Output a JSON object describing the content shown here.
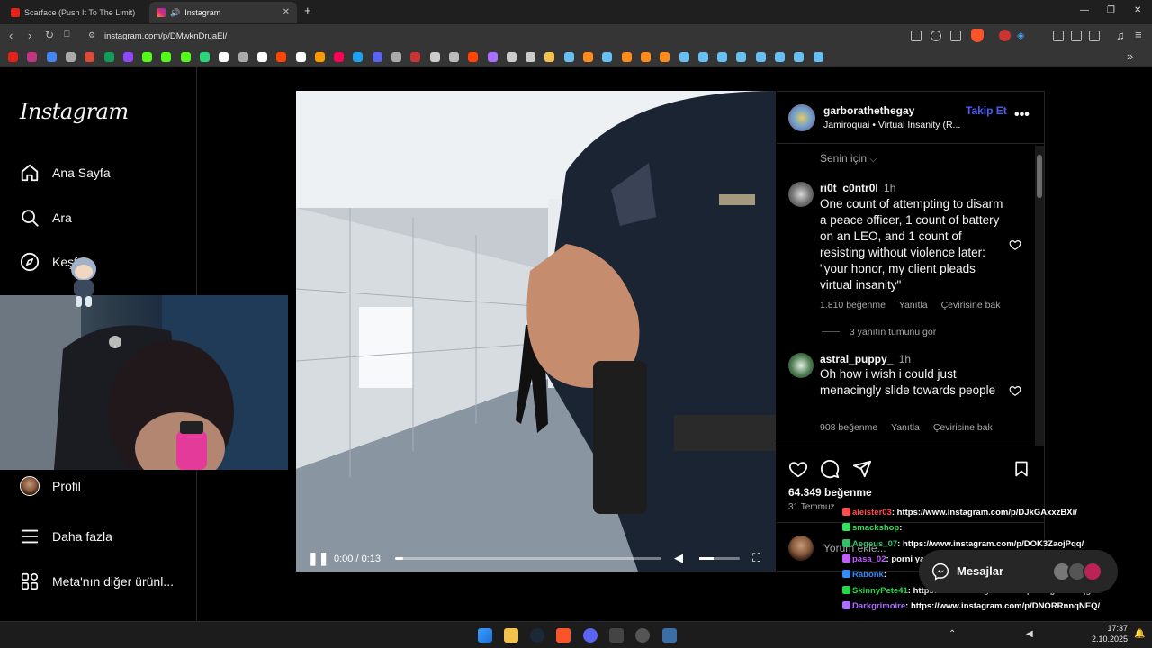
{
  "browser": {
    "tabs": [
      {
        "title": "Scarface (Push It To The Limit) - YouTube",
        "active": false
      },
      {
        "title": "Instagram",
        "active": true
      }
    ],
    "url": "instagram.com/p/DMwknDruaEl/"
  },
  "sidebar": {
    "logo": "Instagram",
    "items": [
      {
        "label": "Ana Sayfa",
        "icon": "home-icon"
      },
      {
        "label": "Ara",
        "icon": "search-icon"
      },
      {
        "label": "Keşfet",
        "icon": "compass-icon"
      },
      {
        "label": "Profil",
        "icon": "avatar"
      },
      {
        "label": "Daha fazla",
        "icon": "menu-icon"
      },
      {
        "label": "Meta'nın diğer ürünl...",
        "icon": "apps-icon"
      }
    ]
  },
  "video": {
    "time": "0:00 / 0:13",
    "progress": 0.03
  },
  "post": {
    "author": "garborathethegay",
    "follow_label": "Takip Et",
    "audio": "Jamiroquai • Virtual Insanity (R...",
    "sort_label": "Senin için",
    "comments": [
      {
        "user": "ri0t_c0ntr0l",
        "time": "1h",
        "text": "One count of attempting to disarm a peace officer, 1 count of battery on an LEO, and 1 count of resisting without violence later: \"your honor, my client pleads virtual insanity\"",
        "likes": "1.810 beğenme",
        "reply": "Yanıtla",
        "translate": "Çevirisine bak",
        "view_replies": "3 yanıtın tümünü gör"
      },
      {
        "user": "astral_puppy_",
        "time": "1h",
        "text": "Oh how i wish i could just menacingly slide towards people",
        "likes": "908 beğenme",
        "reply": "Yanıtla",
        "translate": "Çevirisine bak"
      }
    ],
    "like_count": "64.349 beğenme",
    "date": "31 Temmuz",
    "comment_placeholder": "Yorum ekle..."
  },
  "chat": [
    {
      "user": "aleister03",
      "color": "#ff4d4d",
      "message": ": https://www.instagram.com/p/DJkGAxxzBXi/"
    },
    {
      "user": "smackshop",
      "color": "#34e05a",
      "message": ": "
    },
    {
      "user": "Aegeus_07",
      "color": "#33c06b",
      "message": ": https://www.instagram.com/p/DOK3ZaojPqq/"
    },
    {
      "user": "pasa_02",
      "color": "#c35cff",
      "message": ": porni yazio"
    },
    {
      "user": "Rabonk",
      "color": "#2f8cff",
      "message": ": "
    },
    {
      "user": "SkinnyPete41",
      "color": "#22d94a",
      "message": ": https://www.instagram.com/p/DOqjV-oCBqg/"
    },
    {
      "user": "Darkgrimoire",
      "color": "#a970ff",
      "message": ": https://www.instagram.com/p/DNORRnnqNEQ/"
    }
  ],
  "messages_button": "Mesajlar",
  "taskbar": {
    "time": "17:37",
    "date": "2.10.2025"
  },
  "colors": {
    "accent_blue": "#4a5df9",
    "follow": "#4a5df9"
  }
}
